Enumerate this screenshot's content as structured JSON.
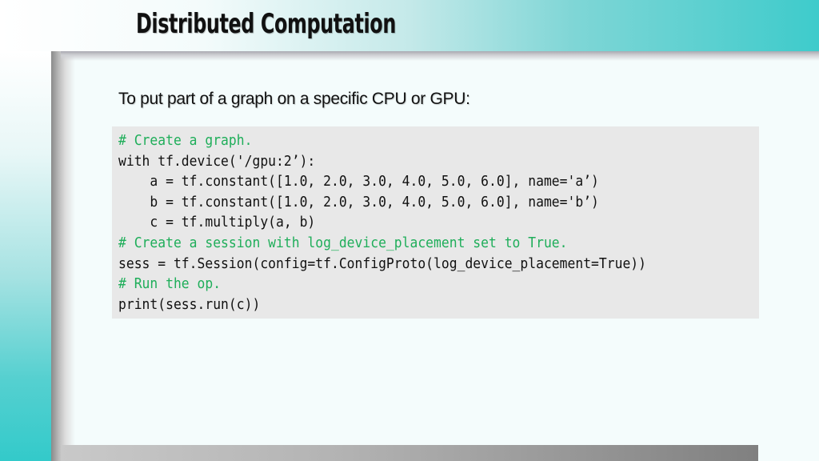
{
  "slide": {
    "title": "Distributed Computation",
    "subtitle": "To put part of a graph on a specific CPU or GPU:",
    "accent_color": "#3ecbcb",
    "comment_color": "#1fae5a"
  },
  "code": {
    "lines": [
      {
        "text": "# Create a graph.",
        "type": "comment"
      },
      {
        "text": "with tf.device('/gpu:2’):",
        "type": "code"
      },
      {
        "text": "    a = tf.constant([1.0, 2.0, 3.0, 4.0, 5.0, 6.0], name='a’)",
        "type": "code"
      },
      {
        "text": "    b = tf.constant([1.0, 2.0, 3.0, 4.0, 5.0, 6.0], name='b’)",
        "type": "code"
      },
      {
        "text": "    c = tf.multiply(a, b)",
        "type": "code"
      },
      {
        "text": "# Create a session with log_device_placement set to True.",
        "type": "comment"
      },
      {
        "text": "sess = tf.Session(config=tf.ConfigProto(log_device_placement=True))",
        "type": "code"
      },
      {
        "text": "# Run the op.",
        "type": "comment"
      },
      {
        "text": "print(sess.run(c))",
        "type": "code"
      }
    ]
  }
}
